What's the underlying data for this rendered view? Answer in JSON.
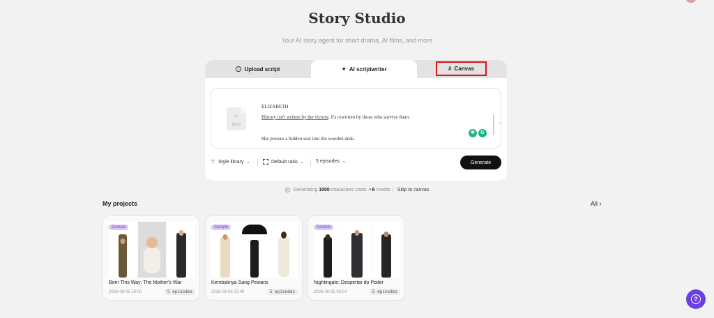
{
  "header": {
    "title": "Story Studio",
    "subtitle": "Your AI story agent for short drama, AI films, and more"
  },
  "tabs": [
    {
      "label": "Upload script",
      "icon": "upload-circle-icon"
    },
    {
      "label": "AI scriptwriter",
      "icon": "sparkle-icon"
    },
    {
      "label": "Canvas",
      "icon": "hash-icon"
    }
  ],
  "editor": {
    "file_label": "docx",
    "lines": [
      "ELIZABETH",
      "History isn't written by the victors",
      "; it's rewritten by those who survive them.",
      "She presses a hidden seal into the wooden desk."
    ]
  },
  "toolbar": {
    "style_library": "Style library",
    "ratio": "Default ratio",
    "episodes": "5 episodes",
    "generate": "Generate"
  },
  "info": {
    "prefix": "Generating",
    "chars": "1000",
    "middle": "characters costs",
    "credits_value": "6",
    "credits_label": "credits",
    "skip": "Skip to canvas"
  },
  "projects": {
    "title": "My projects",
    "all_label": "All",
    "items": [
      {
        "badge": "Sample",
        "name": "Born This Way: The Mother's War",
        "date": "2026-08-05 16:00",
        "episodes": "5 episodes"
      },
      {
        "badge": "Sample",
        "name": "Kembalinya Sang Pewaris",
        "date": "2026-08-05 23:49",
        "episodes": "5 episodes"
      },
      {
        "badge": "Sample",
        "name": "Nightingale: Despertar do Poder",
        "date": "2026-08-05 03:54",
        "episodes": "5 episodes"
      }
    ]
  },
  "colors": {
    "accent": "#6b3fe0",
    "highlight_border": "#e0101c",
    "badge_text": "#7446c9",
    "badge_bg": "#d9c8f5"
  }
}
